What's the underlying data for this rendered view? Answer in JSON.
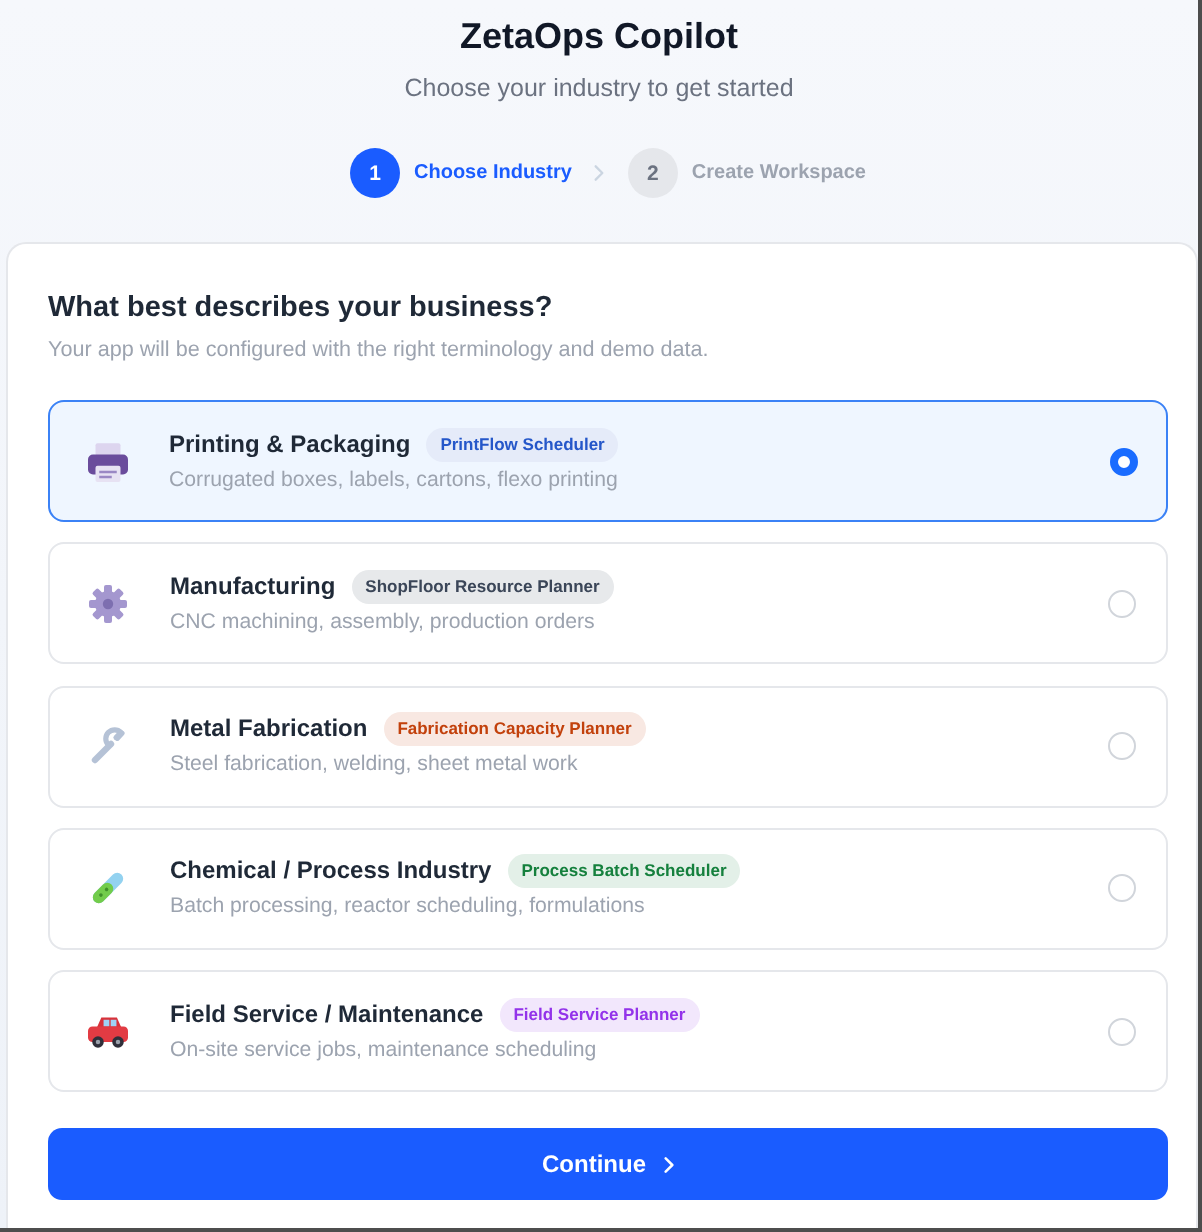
{
  "app": {
    "title": "ZetaOps Copilot",
    "subtitle": "Choose your industry to get started"
  },
  "steps": [
    {
      "number": "1",
      "label": "Choose Industry",
      "active": true
    },
    {
      "number": "2",
      "label": "Create Workspace",
      "active": false
    }
  ],
  "form": {
    "heading": "What best describes your business?",
    "description": "Your app will be configured with the right terminology and demo data.",
    "options": [
      {
        "title": "Printing & Packaging",
        "badge": {
          "text": "PrintFlow Scheduler",
          "color": "#2557c9"
        },
        "description": "Corrugated boxes, labels, cartons, flexo printing",
        "selected": true
      },
      {
        "title": "Manufacturing",
        "badge": {
          "text": "ShopFloor Resource Planner",
          "color": "#3b4658"
        },
        "description": "CNC machining, assembly, production orders",
        "selected": false
      },
      {
        "title": "Metal Fabrication",
        "badge": {
          "text": "Fabrication Capacity Planner",
          "color": "#c2410c"
        },
        "description": "Steel fabrication, welding, sheet metal work",
        "selected": false
      },
      {
        "title": "Chemical / Process Industry",
        "badge": {
          "text": "Process Batch Scheduler",
          "color": "#15803d"
        },
        "description": "Batch processing, reactor scheduling, formulations",
        "selected": false
      },
      {
        "title": "Field Service / Maintenance",
        "badge": {
          "text": "Field Service Planner",
          "color": "#9333ea"
        },
        "description": "On-site service jobs, maintenance scheduling",
        "selected": false
      }
    ]
  },
  "continue_button": {
    "label": "Continue"
  }
}
